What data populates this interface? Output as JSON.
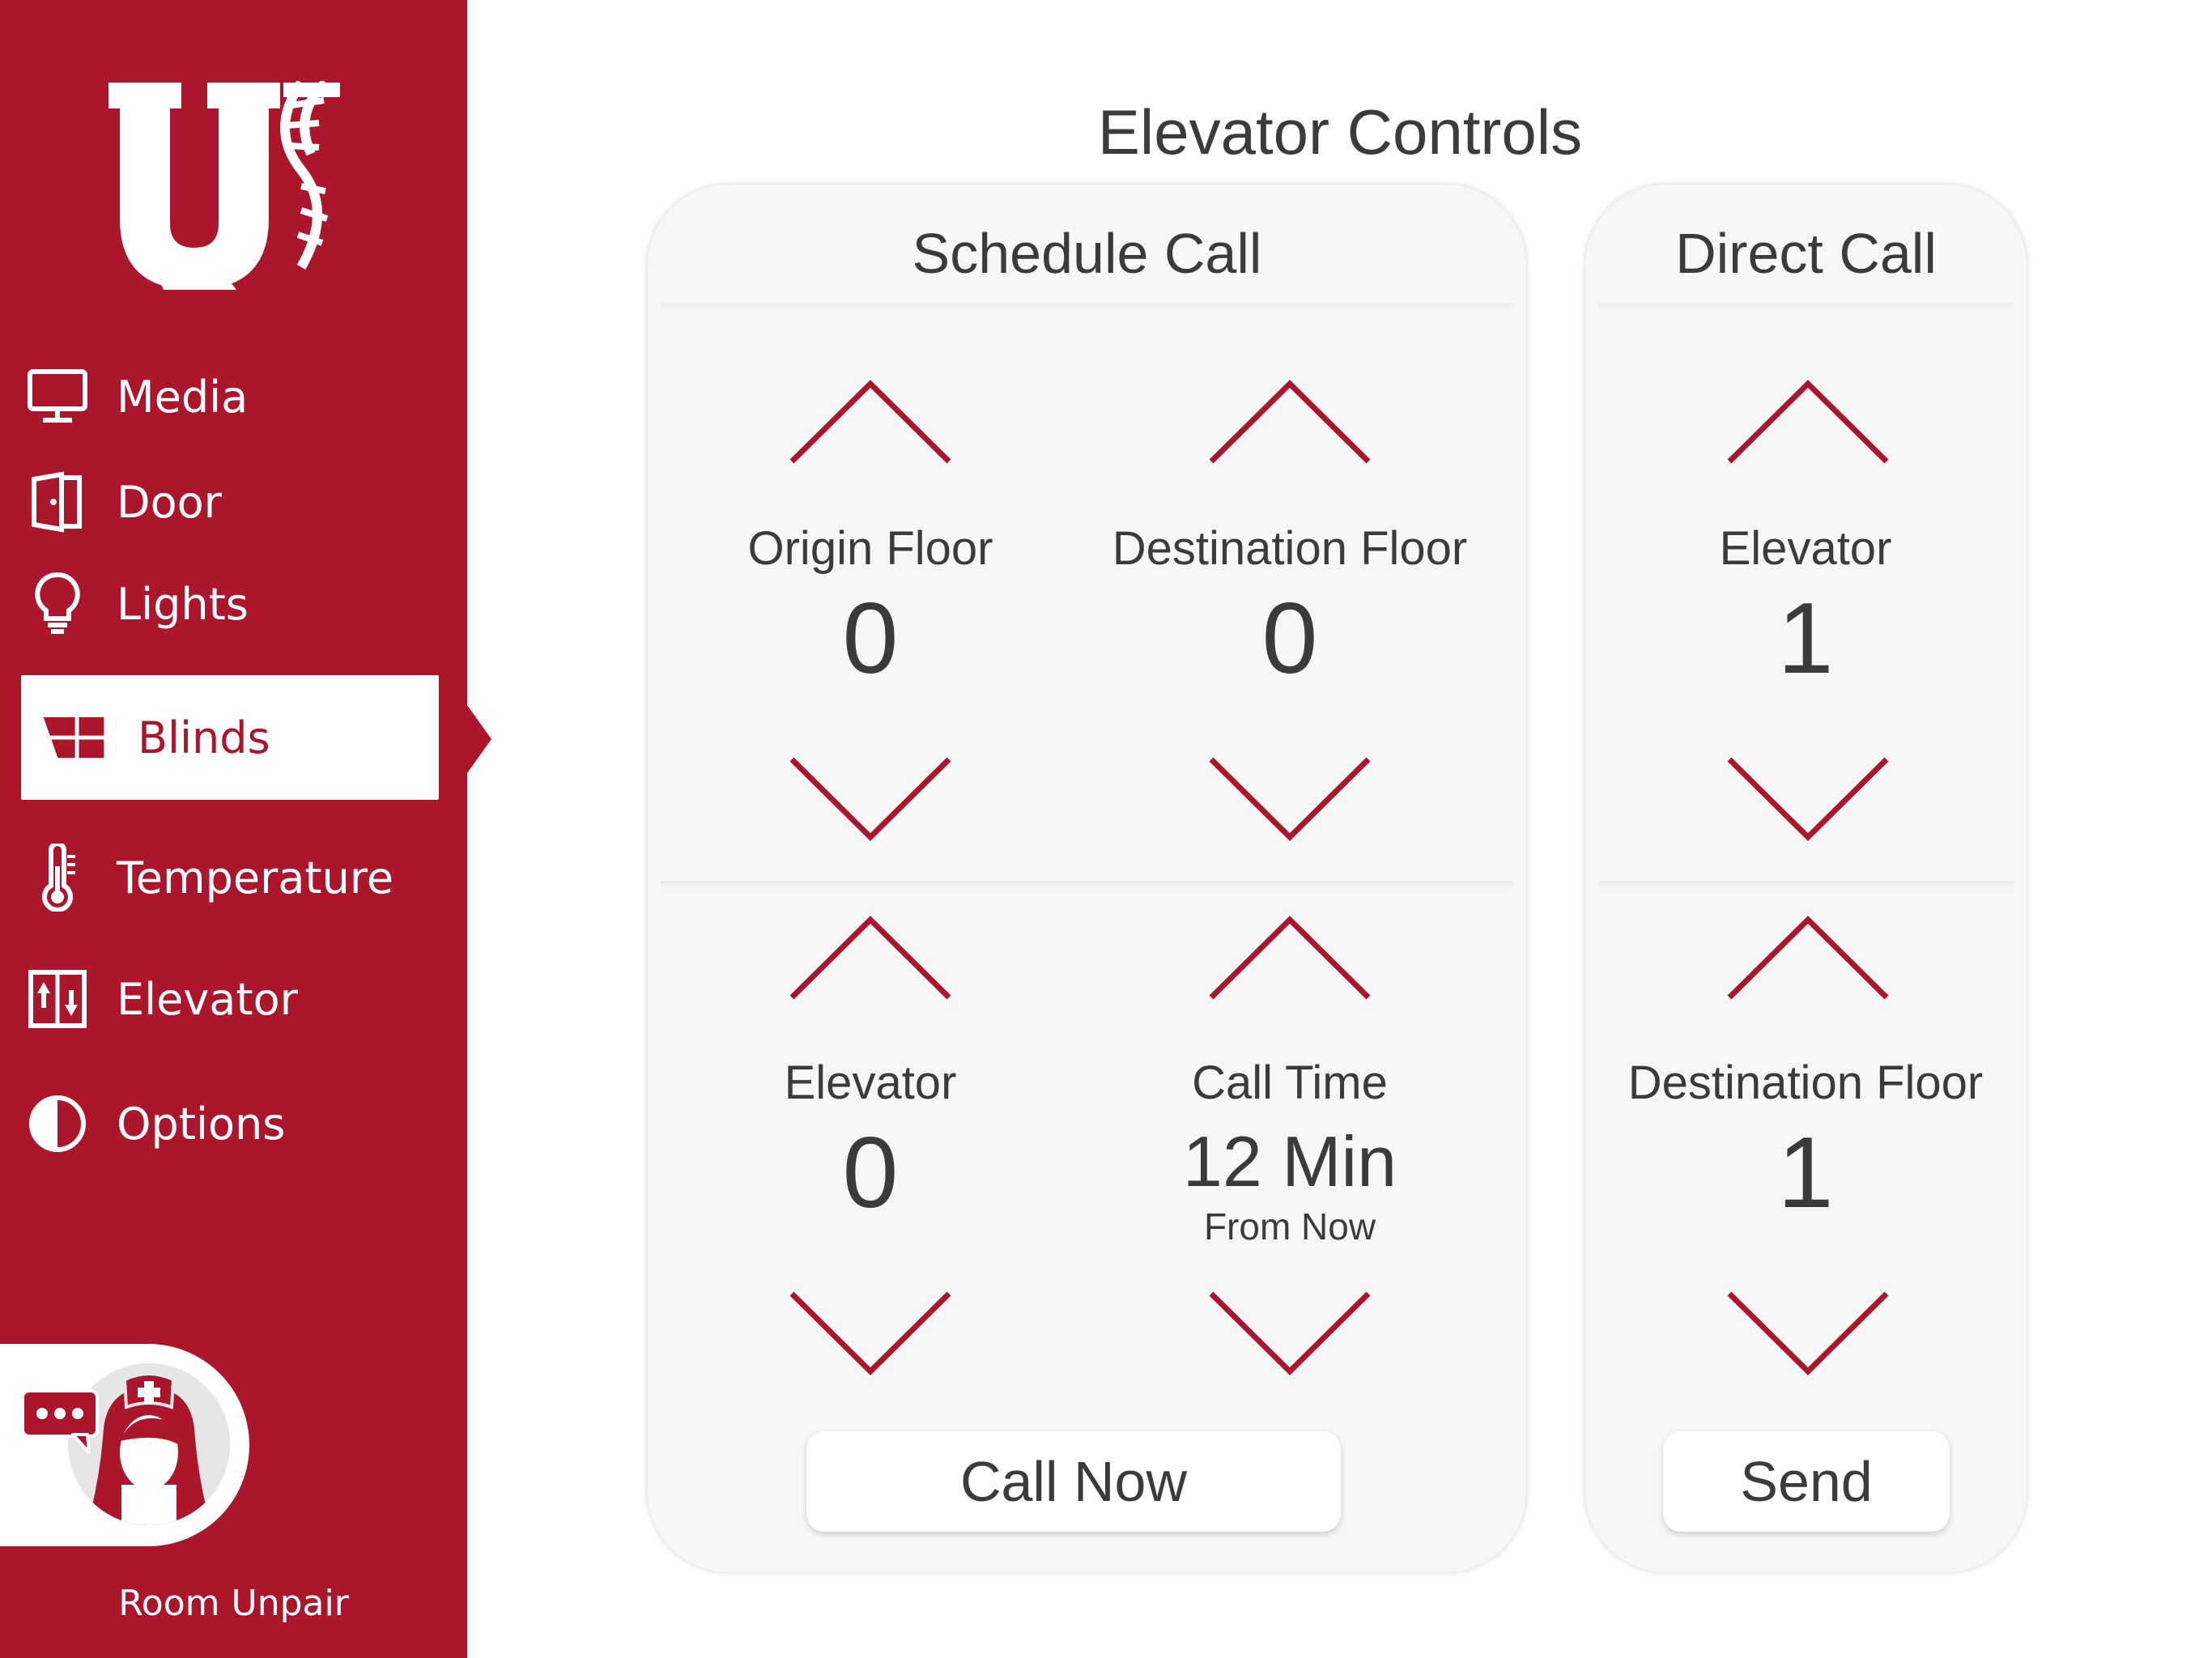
{
  "colors": {
    "brand": "#ac162c",
    "text": "#3b3b3b",
    "panel": "#f7f7f7"
  },
  "sidebar": {
    "logo_icon": "u-dna-logo",
    "items": [
      {
        "label": "Media",
        "icon": "monitor-icon"
      },
      {
        "label": "Door",
        "icon": "door-icon"
      },
      {
        "label": "Lights",
        "icon": "lightbulb-icon"
      },
      {
        "label": "Blinds",
        "icon": "blinds-icon",
        "active": true
      },
      {
        "label": "Temperature",
        "icon": "thermometer-icon"
      },
      {
        "label": "Elevator",
        "icon": "elevator-icon"
      },
      {
        "label": "Options",
        "icon": "half-circle-icon"
      }
    ],
    "nurse_call_icon": "nurse-chat-icon",
    "unpair_label": "Room Unpair"
  },
  "main": {
    "title": "Elevator Controls",
    "schedule": {
      "header": "Schedule Call",
      "origin_label": "Origin Floor",
      "origin_value": "0",
      "destination_label": "Destination Floor",
      "destination_value": "0",
      "elevator_label": "Elevator",
      "elevator_value": "0",
      "calltime_label": "Call Time",
      "calltime_value": "12 Min",
      "calltime_sub": "From Now",
      "call_now_label": "Call Now"
    },
    "direct": {
      "header": "Direct Call",
      "elevator_label": "Elevator",
      "elevator_value": "1",
      "destination_label": "Destination Floor",
      "destination_value": "1",
      "send_label": "Send"
    }
  }
}
